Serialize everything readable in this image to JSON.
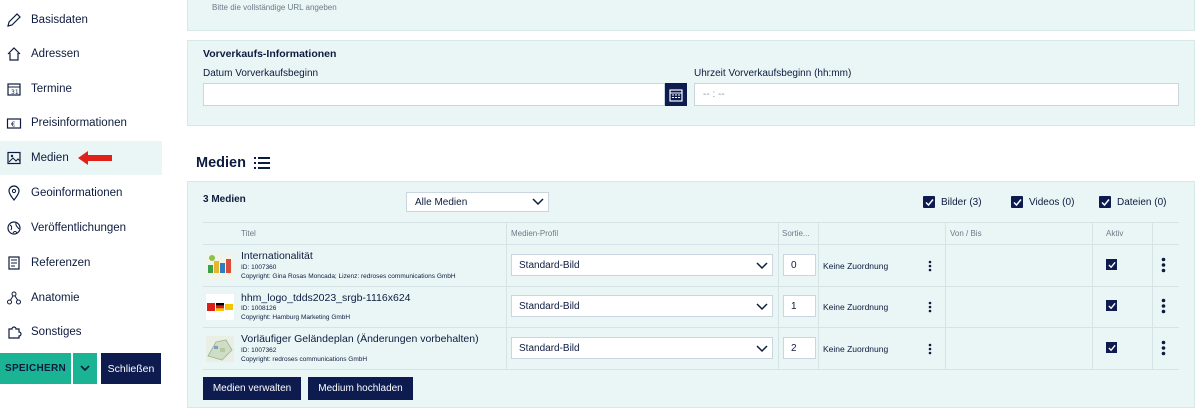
{
  "sidebar": {
    "items": [
      {
        "label": "Basisdaten",
        "icon": "pencil-icon"
      },
      {
        "label": "Adressen",
        "icon": "house-icon"
      },
      {
        "label": "Termine",
        "icon": "calendar-icon"
      },
      {
        "label": "Preisinformationen",
        "icon": "banknote-icon"
      },
      {
        "label": "Medien",
        "icon": "image-icon"
      },
      {
        "label": "Geoinformationen",
        "icon": "map-pin-icon"
      },
      {
        "label": "Veröffentlichungen",
        "icon": "globe-icon"
      },
      {
        "label": "Referenzen",
        "icon": "document-icon"
      },
      {
        "label": "Anatomie",
        "icon": "network-icon"
      },
      {
        "label": "Sonstiges",
        "icon": "puzzle-icon"
      }
    ],
    "save_label": "SPEICHERN",
    "close_label": "Schließen"
  },
  "url_hint": "Bitte die vollständige URL angeben",
  "presale": {
    "title": "Vorverkaufs-Informationen",
    "date_label": "Datum Vorverkaufsbeginn",
    "date_value": "",
    "time_label": "Uhrzeit Vorverkaufsbeginn (hh:mm)",
    "time_placeholder": "-- : --"
  },
  "media": {
    "title": "Medien",
    "count": "3 Medien",
    "filter_value": "Alle Medien",
    "checkboxes": [
      {
        "label": "Bilder (3)",
        "checked": true
      },
      {
        "label": "Videos (0)",
        "checked": true
      },
      {
        "label": "Dateien (0)",
        "checked": true
      }
    ],
    "columns": [
      "Titel",
      "Medien-Profil",
      "Sortie...",
      "Von / Bis",
      "Aktiv"
    ],
    "rows": [
      {
        "title": "Internationalität",
        "id": "ID: 1007360",
        "copyright": "Copyright: Gina Rosas Moncada; Lizenz: redroses communications GmbH",
        "profile": "Standard-Bild",
        "sort": "0",
        "assignment": "Keine Zuordnung",
        "active": true
      },
      {
        "title": "hhm_logo_tdds2023_srgb-1116x624",
        "id": "ID: 1008126",
        "copyright": "Copyright: Hamburg Marketing GmbH",
        "profile": "Standard-Bild",
        "sort": "1",
        "assignment": "Keine Zuordnung",
        "active": true
      },
      {
        "title": "Vorläufiger Geländeplan (Änderungen vorbehalten)",
        "id": "ID: 1007362",
        "copyright": "Copyright: redroses communications GmbH",
        "profile": "Standard-Bild",
        "sort": "2",
        "assignment": "Keine Zuordnung",
        "active": true
      }
    ],
    "manage_label": "Medien verwalten",
    "upload_label": "Medium hochladen"
  },
  "colors": {
    "navy": "#0d1b4f",
    "teal_panel": "#eaf6f6",
    "green": "#1ab394",
    "red_arrow": "#e0201b"
  }
}
